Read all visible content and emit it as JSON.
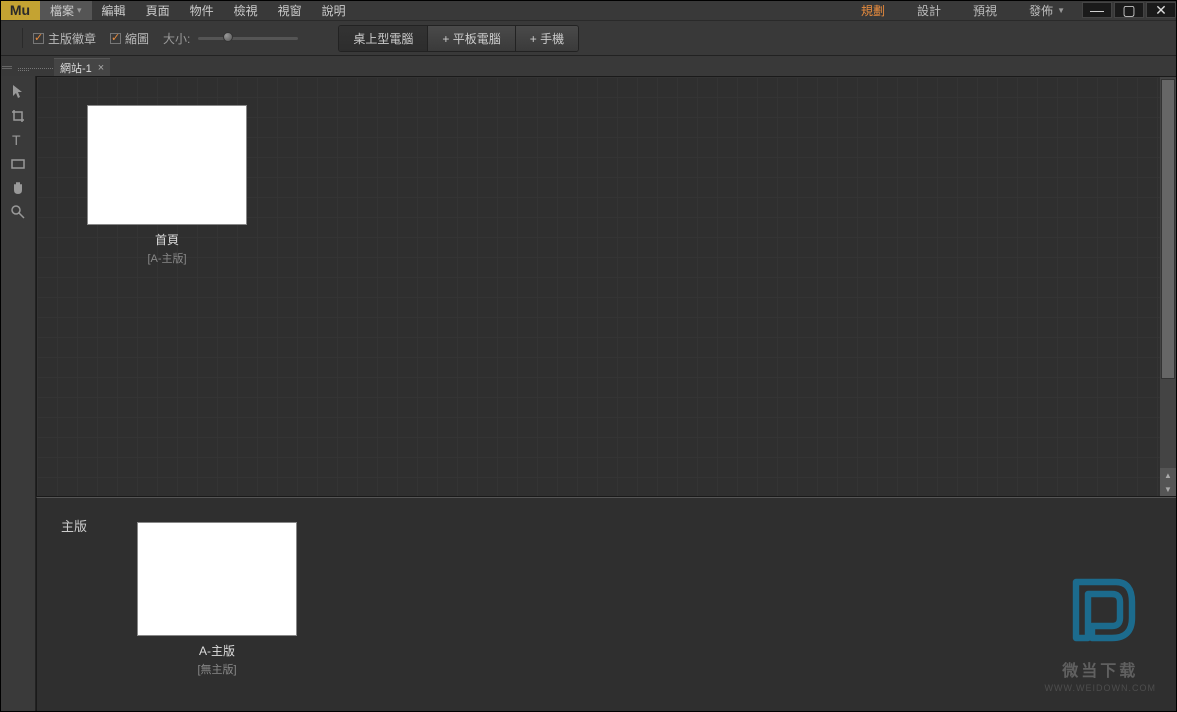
{
  "app": {
    "logo": "Mu"
  },
  "menu": [
    {
      "label": "檔案",
      "active": true
    },
    {
      "label": "編輯"
    },
    {
      "label": "頁面"
    },
    {
      "label": "物件"
    },
    {
      "label": "檢視"
    },
    {
      "label": "視窗"
    },
    {
      "label": "說明"
    }
  ],
  "nav": [
    {
      "label": "規劃",
      "active": true
    },
    {
      "label": "設計"
    },
    {
      "label": "預視"
    },
    {
      "label": "發佈",
      "dropdown": true
    }
  ],
  "options": {
    "checkbox1": "主版徽章",
    "checkbox2": "縮圖",
    "size_label": "大小:",
    "devices": [
      {
        "label": "桌上型電腦",
        "active": true
      },
      {
        "label": "+ 平板電腦"
      },
      {
        "label": "+ 手機"
      }
    ]
  },
  "tab": {
    "name": "網站-1"
  },
  "pages": {
    "home": {
      "title": "首頁",
      "subtitle": "[A-主版]"
    }
  },
  "masters": {
    "section_label": "主版",
    "a_master": {
      "title": "A-主版",
      "subtitle": "[無主版]"
    }
  },
  "watermark": {
    "line1": "微当下载",
    "line2": "WWW.WEIDOWN.COM"
  }
}
